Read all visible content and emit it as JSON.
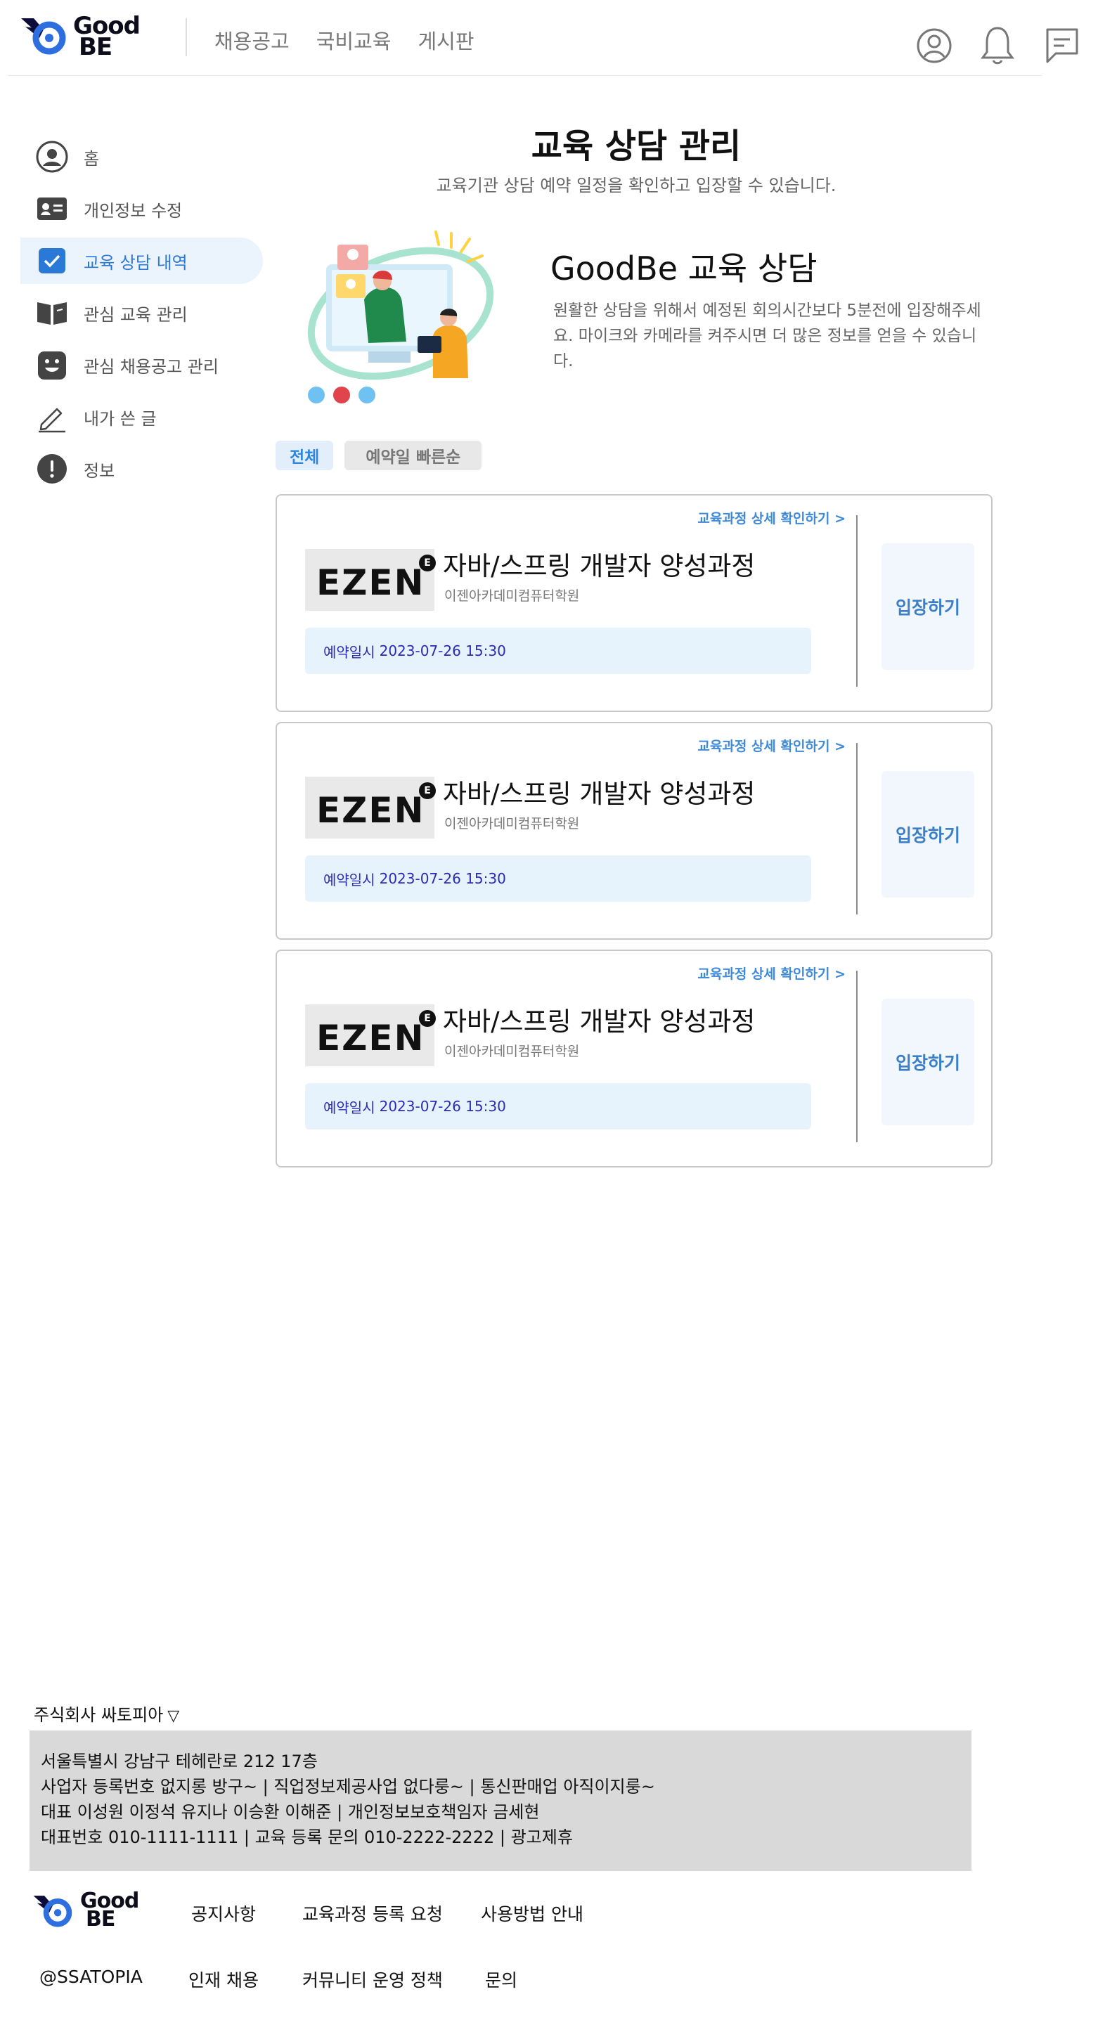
{
  "header": {
    "logo": {
      "line1": "Good",
      "line2": "BE"
    },
    "nav": [
      "채용공고",
      "국비교육",
      "게시판"
    ],
    "icons": [
      "user-circle-icon",
      "bell-icon",
      "message-icon"
    ]
  },
  "sidebar": {
    "items": [
      {
        "label": "홈",
        "icon": "user-circle-icon",
        "active": false
      },
      {
        "label": "개인정보 수정",
        "icon": "id-card-icon",
        "active": false
      },
      {
        "label": "교육 상담 내역",
        "icon": "checkbox-icon",
        "active": true
      },
      {
        "label": "관심 교육 관리",
        "icon": "book-icon",
        "active": false
      },
      {
        "label": "관심 채용공고 관리",
        "icon": "smile-icon",
        "active": false
      },
      {
        "label": "내가 쓴 글",
        "icon": "pencil-icon",
        "active": false
      },
      {
        "label": "정보",
        "icon": "info-icon",
        "active": false
      }
    ]
  },
  "main": {
    "title": "교육 상담 관리",
    "subtitle": "교육기관 상담 예약 일정을 확인하고 입장할 수 있습니다.",
    "hero": {
      "title": "GoodBe 교육 상담",
      "desc": "원활한 상담을 위해서 예정된 회의시간보다 5분전에 입장해주세요. 마이크와 카메라를 켜주시면 더 많은 정보를 얻을 수 있습니다."
    },
    "filters": [
      "전체",
      "예약일 빠른순"
    ],
    "cards": [
      {
        "detail_link": "교육과정 상세 확인하기 >",
        "logo_text": "EZEN",
        "logo_badge": "E",
        "course": "자바/스프링 개발자 양성과정",
        "academy": "이젠아카데미컴퓨터학원",
        "reserve_label": "예약일시",
        "reserve_value": "2023-07-26 15:30",
        "enter": "입장하기"
      },
      {
        "detail_link": "교육과정 상세 확인하기 >",
        "logo_text": "EZEN",
        "logo_badge": "E",
        "course": "자바/스프링 개발자 양성과정",
        "academy": "이젠아카데미컴퓨터학원",
        "reserve_label": "예약일시",
        "reserve_value": "2023-07-26 15:30",
        "enter": "입장하기"
      },
      {
        "detail_link": "교육과정 상세 확인하기 >",
        "logo_text": "EZEN",
        "logo_badge": "E",
        "course": "자바/스프링 개발자 양성과정",
        "academy": "이젠아카데미컴퓨터학원",
        "reserve_label": "예약일시",
        "reserve_value": "2023-07-26 15:30",
        "enter": "입장하기"
      }
    ]
  },
  "footer": {
    "company": "주식회사 싸토피아",
    "company_toggle": "▽",
    "lines": [
      "서울특별시 강남구 테헤란로 212 17층",
      "사업자 등록번호  없지롱 방구~ | 직업정보제공사업 없다룽~ | 통신판매업 아직이지룽~",
      "대표 이성원 이정석 유지나 이승환 이해준 | 개인정보보호책임자 금세현",
      "대표번호 010-1111-1111 | 교육 등록 문의 010-2222-2222 | 광고제휴"
    ],
    "logo": {
      "line1": "Good",
      "line2": "BE"
    },
    "links_row1": [
      "공지사항",
      "교육과정 등록 요청",
      "사용방법 안내"
    ],
    "handle": "@SSATOPIA",
    "links_row2": [
      "인재 채용",
      "커뮤니티 운영 정책",
      "문의"
    ]
  },
  "colors": {
    "accent": "#2a79d6",
    "active_bg": "#ebf3fd",
    "logo_blue": "#2e6fe0",
    "logo_navy": "#0c0c3a"
  }
}
